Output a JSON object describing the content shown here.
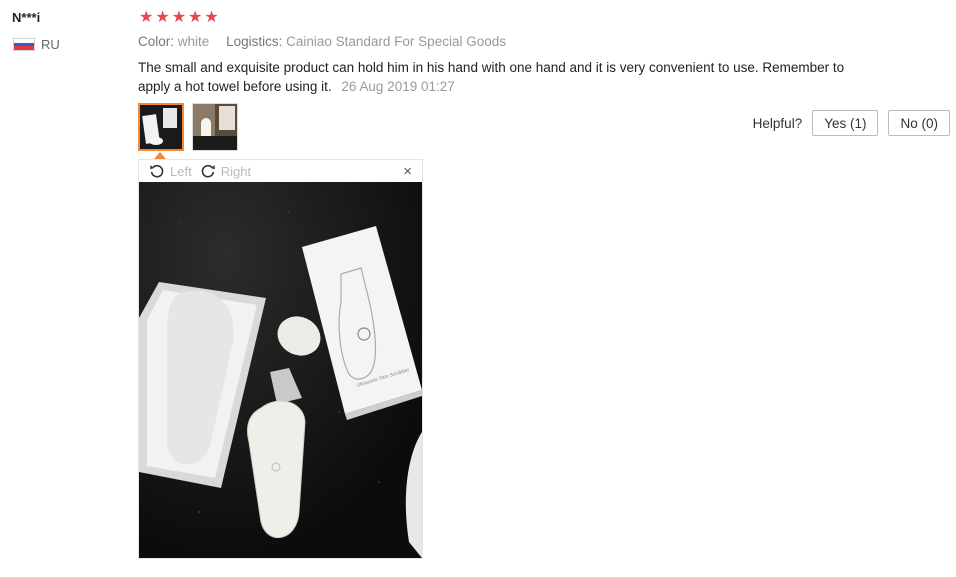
{
  "user": {
    "name": "N***i",
    "country": "RU"
  },
  "review": {
    "rating": 5,
    "stars": [
      "★",
      "★",
      "★",
      "★",
      "★"
    ],
    "color_label": "Color:",
    "color_value": "white",
    "logistics_label": "Logistics:",
    "logistics_value": "Cainiao Standard For Special Goods",
    "text": "The small and exquisite product can hold him in his hand with one hand and it is very convenient to use. Remember to apply a hot towel before using it.",
    "date": "26 Aug 2019 01:27"
  },
  "helpful": {
    "label": "Helpful?",
    "yes": "Yes (1)",
    "no": "No (0)"
  },
  "viewer": {
    "rotate_left": "Left",
    "rotate_right": "Right",
    "close": "×",
    "box_caption": "Ultrasonic Skin Scrubber"
  },
  "colors": {
    "star": "#e8474c",
    "active_border": "#f08a3a"
  }
}
